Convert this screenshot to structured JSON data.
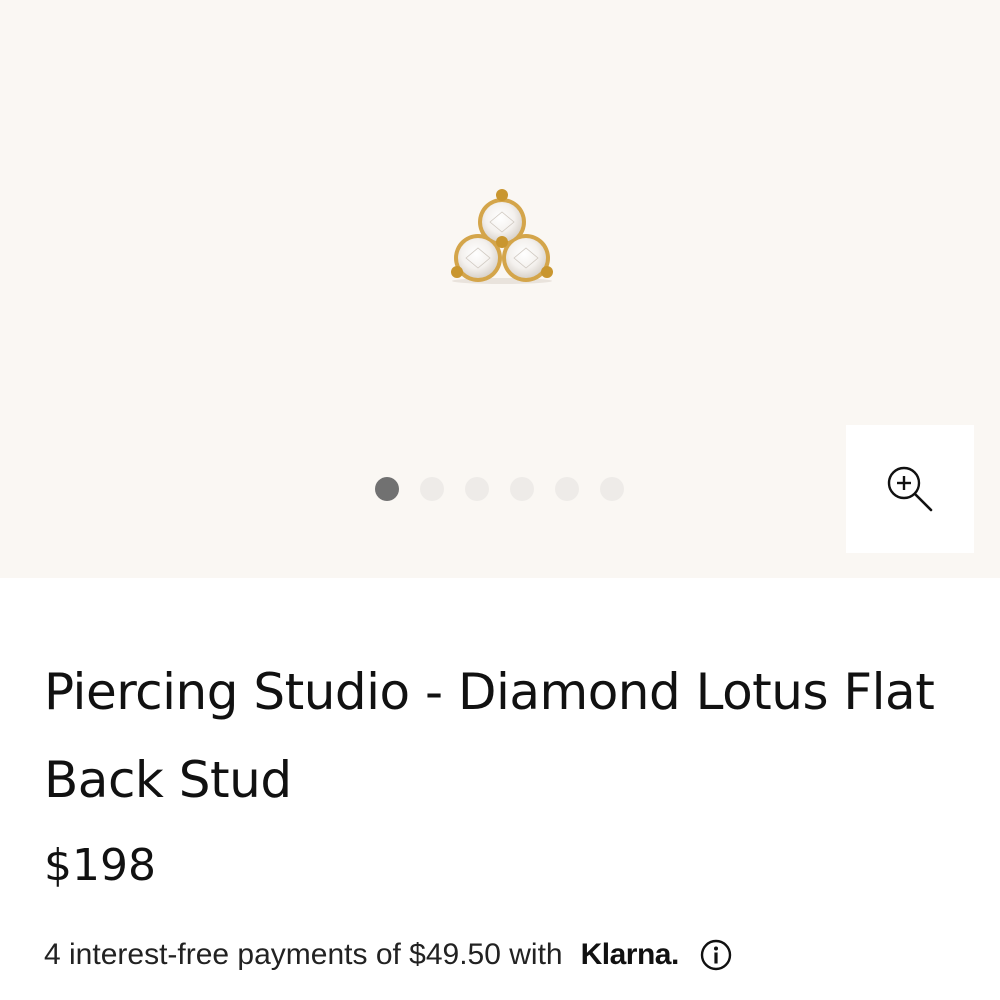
{
  "product": {
    "title": "Piercing Studio - Diamond Lotus Flat Back Stud",
    "price": "$198",
    "image_icon": "gold-three-diamond-cluster-stud"
  },
  "gallery": {
    "dots": [
      {
        "active": true
      },
      {
        "active": false
      },
      {
        "active": false
      },
      {
        "active": false
      },
      {
        "active": false
      },
      {
        "active": false
      }
    ],
    "zoom_icon": "zoom-in-icon",
    "background_color": "#faf7f3",
    "active_dot_color": "#717171",
    "inactive_dot_color": "#eeebe8"
  },
  "payment": {
    "installment_text": "4 interest-free payments of $49.50 with",
    "provider": "Klarna.",
    "info_icon": "info-icon"
  }
}
